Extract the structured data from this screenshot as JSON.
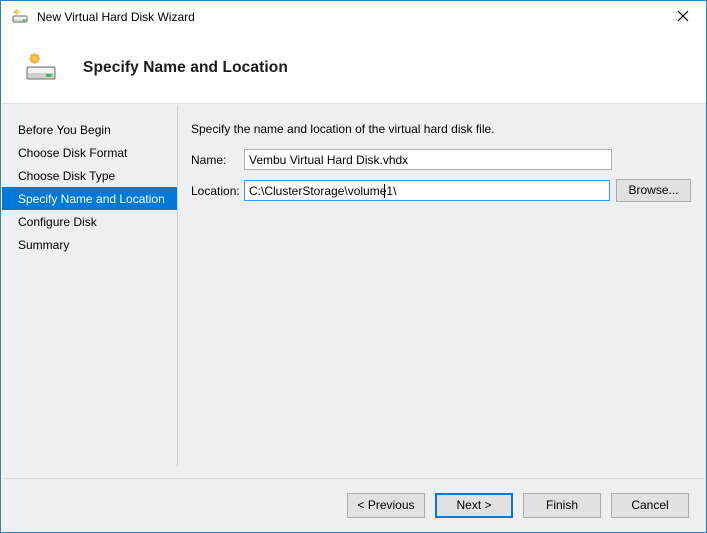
{
  "window": {
    "title": "New Virtual Hard Disk Wizard",
    "title_icon": "new-virtual-hard-disk-icon",
    "close_icon": "close-icon",
    "border_color": "#2680C4"
  },
  "header": {
    "icon": "new-virtual-hard-disk-icon",
    "title": "Specify Name and Location"
  },
  "sidebar": {
    "items": [
      {
        "label": "Before You Begin",
        "selected": false
      },
      {
        "label": "Choose Disk Format",
        "selected": false
      },
      {
        "label": "Choose Disk Type",
        "selected": false
      },
      {
        "label": "Specify Name and Location",
        "selected": true
      },
      {
        "label": "Configure Disk",
        "selected": false
      },
      {
        "label": "Summary",
        "selected": false
      }
    ],
    "selected_bg": "#0078D7",
    "selected_fg": "#FFFFFF"
  },
  "content": {
    "intro": "Specify the name and location of the virtual hard disk file.",
    "fields": {
      "name": {
        "label": "Name:",
        "value": "Vembu Virtual Hard Disk.vhdx",
        "placeholder": "",
        "focused": false
      },
      "location": {
        "label": "Location:",
        "value": "C:\\ClusterStorage\\volume1\\",
        "placeholder": "",
        "focused": true,
        "focus_border_color": "#3399FF"
      }
    },
    "browse_label": "Browse..."
  },
  "footer": {
    "buttons": [
      {
        "label": "< Previous",
        "default": false
      },
      {
        "label": "Next >",
        "default": true
      },
      {
        "label": "Finish",
        "default": false
      },
      {
        "label": "Cancel",
        "default": false
      }
    ],
    "default_border_color": "#0078D7"
  }
}
